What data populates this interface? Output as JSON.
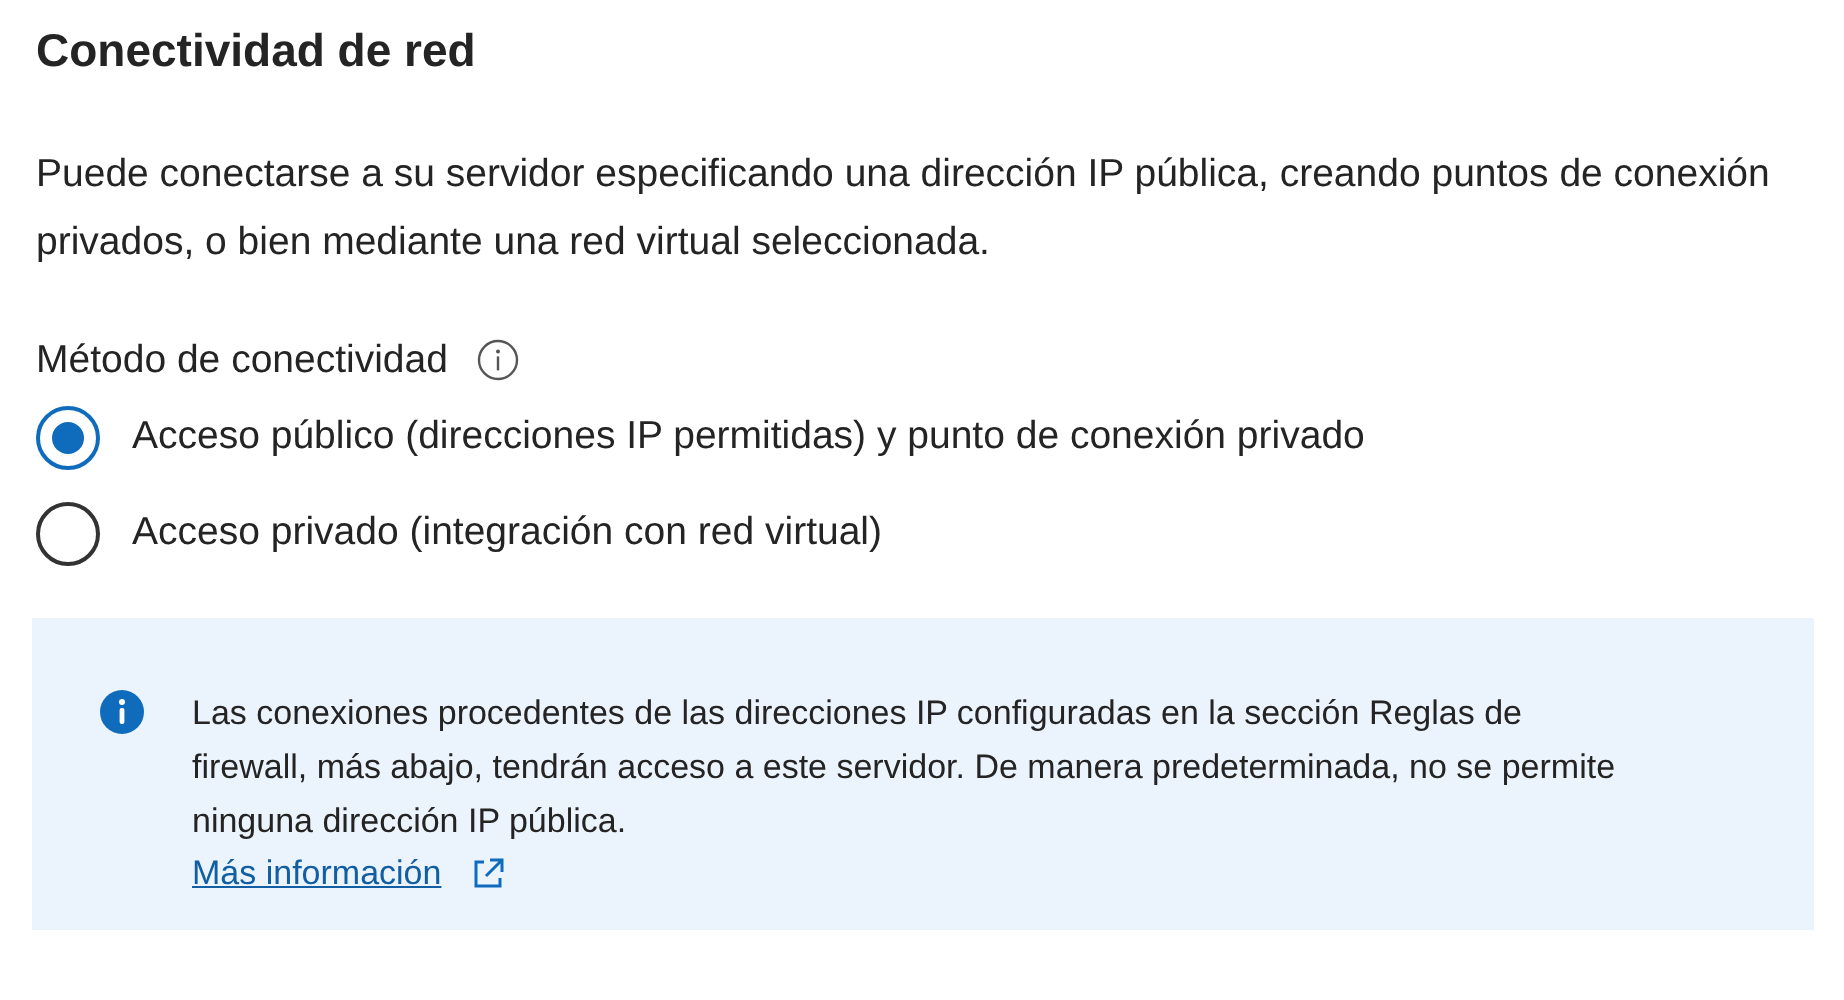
{
  "title": "Conectividad de red",
  "description": "Puede conectarse a su servidor especificando una dirección IP pública, creando puntos de conexión privados, o bien mediante una red virtual seleccionada.",
  "connectivity": {
    "label": "Método de conectividad",
    "options": [
      {
        "label": "Acceso público (direcciones IP permitidas) y punto de conexión privado",
        "selected": true
      },
      {
        "label": "Acceso privado (integración con red virtual)",
        "selected": false
      }
    ]
  },
  "info": {
    "text": "Las conexiones procedentes de las direcciones IP configuradas en la sección Reglas de firewall, más abajo, tendrán acceso a este servidor. De manera predeterminada, no se permite ninguna dirección IP pública.",
    "link": "Más información"
  }
}
